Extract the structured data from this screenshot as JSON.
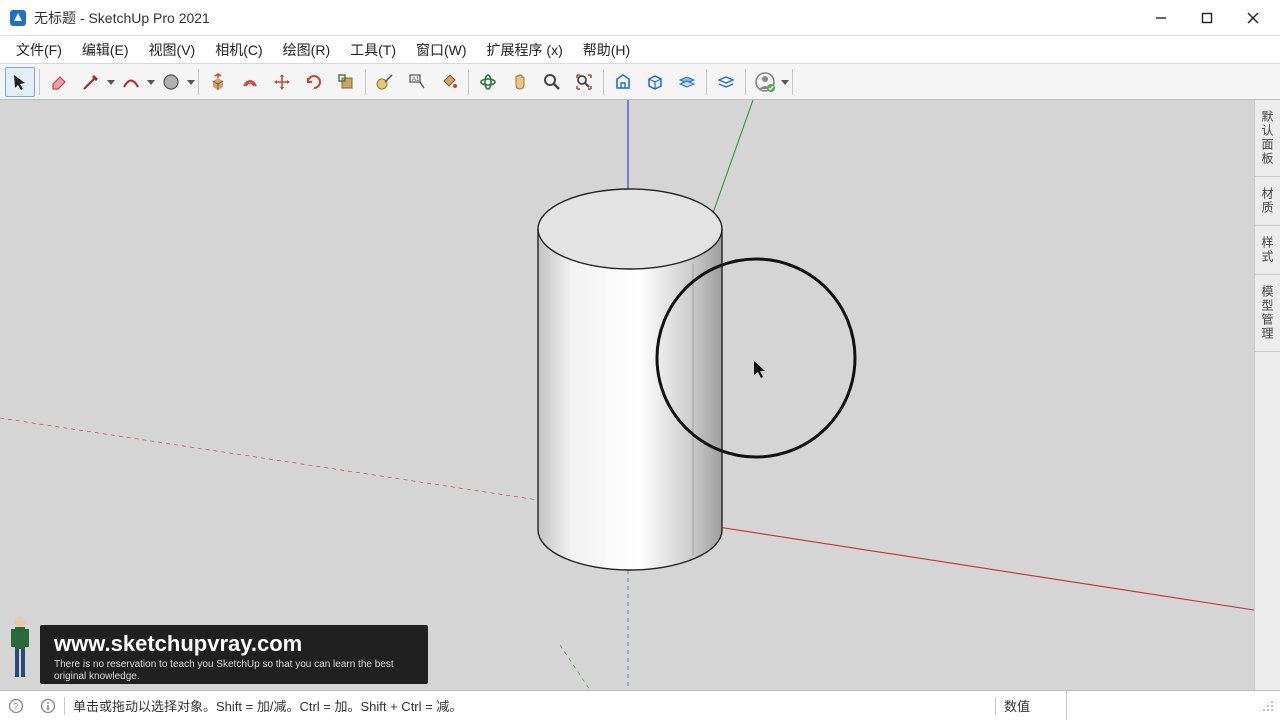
{
  "window": {
    "title": "无标题 - SketchUp Pro 2021"
  },
  "menu": {
    "file": "文件(F)",
    "edit": "编辑(E)",
    "view": "视图(V)",
    "camera": "相机(C)",
    "draw": "绘图(R)",
    "tools": "工具(T)",
    "window": "窗口(W)",
    "extensions": "扩展程序 (x)",
    "help": "帮助(H)"
  },
  "tray": {
    "default_panel": "默认面板",
    "materials": "材质",
    "styles": "样式",
    "model_manage": "模型管理"
  },
  "watermark": {
    "url": "www.sketchupvray.com",
    "subtitle": "There is no reservation to teach you SketchUp so that you can learn the best original knowledge."
  },
  "status": {
    "hint": "单击或拖动以选择对象。Shift = 加/减。Ctrl = 加。Shift + Ctrl = 减。",
    "value_label": "数值"
  }
}
